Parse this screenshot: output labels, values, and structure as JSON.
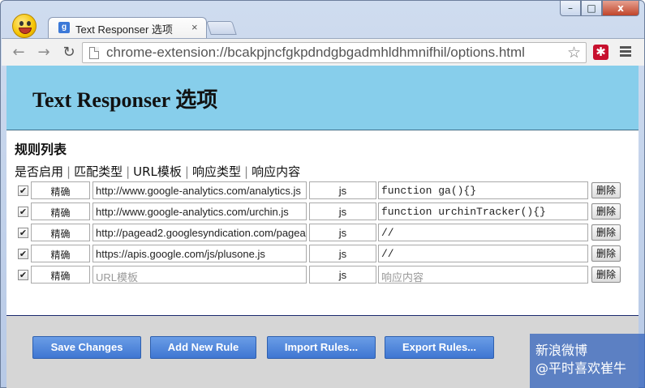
{
  "window": {
    "tab_title": "Text Responser 选项",
    "tab_close": "×",
    "tab_favicon_letter": "g",
    "controls": {
      "minimize": "–",
      "maximize": "□",
      "close": "x"
    }
  },
  "toolbar": {
    "back": "←",
    "forward": "→",
    "reload": "↻",
    "url": "chrome-extension://bcakpjncfgkpdndgbgadmhldhmnifhil/options.html",
    "star": "☆",
    "extension_icon": "✱"
  },
  "page": {
    "title": "Text Responser 选项",
    "section_title": "规则列表",
    "column_headers": [
      "是否启用",
      "匹配类型",
      "URL模板",
      "响应类型",
      "响应内容"
    ],
    "rows": [
      {
        "enabled": true,
        "match": "精确",
        "url": "http://www.google-analytics.com/analytics.js",
        "url_placeholder": false,
        "type": "js",
        "content": "function ga(){}",
        "content_placeholder": false,
        "delete": "删除"
      },
      {
        "enabled": true,
        "match": "精确",
        "url": "http://www.google-analytics.com/urchin.js",
        "url_placeholder": false,
        "type": "js",
        "content": "function urchinTracker(){}",
        "content_placeholder": false,
        "delete": "删除"
      },
      {
        "enabled": true,
        "match": "精确",
        "url": "http://pagead2.googlesyndication.com/pagea",
        "url_placeholder": false,
        "type": "js",
        "content": "//",
        "content_placeholder": false,
        "delete": "删除"
      },
      {
        "enabled": true,
        "match": "精确",
        "url": "https://apis.google.com/js/plusone.js",
        "url_placeholder": false,
        "type": "js",
        "content": "//",
        "content_placeholder": false,
        "delete": "删除"
      },
      {
        "enabled": true,
        "match": "精确",
        "url": "URL模板",
        "url_placeholder": true,
        "type": "js",
        "content": "响应内容",
        "content_placeholder": true,
        "delete": "删除"
      }
    ],
    "buttons": {
      "save": "Save Changes",
      "add": "Add New Rule",
      "import": "Import Rules...",
      "export": "Export Rules..."
    }
  },
  "watermark": {
    "line1": "新浪微博",
    "line2": "@平时喜欢崔牛"
  },
  "colors": {
    "header_bg": "#87ceeb",
    "button_bg": "#4a7fd8",
    "footer_bg": "#d6d6d6"
  }
}
